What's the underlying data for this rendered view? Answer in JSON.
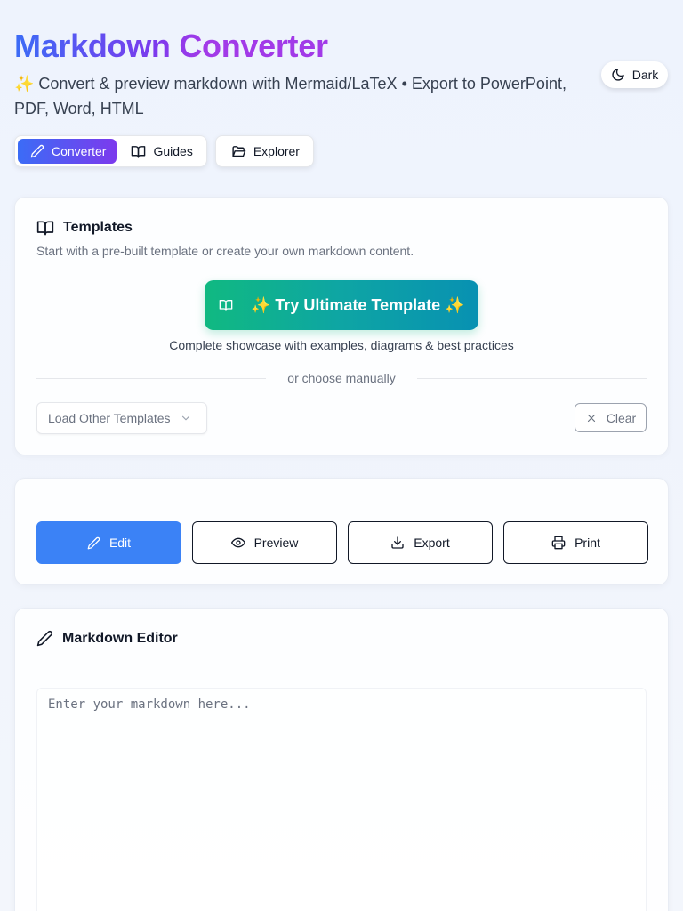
{
  "header": {
    "title": "Markdown Converter",
    "subtitle": "✨ Convert & preview markdown with Mermaid/LaTeX • Export to PowerPoint, PDF, Word, HTML",
    "theme_toggle": {
      "label": "Dark",
      "icon": "moon-icon"
    }
  },
  "nav": {
    "tabs": [
      {
        "label": "Converter",
        "icon": "pencil-icon",
        "active": true
      },
      {
        "label": "Guides",
        "icon": "book-icon",
        "active": false
      },
      {
        "label": "Explorer",
        "icon": "folder-open-icon",
        "active": false
      }
    ]
  },
  "templates": {
    "title": "Templates",
    "description": "Start with a pre-built template or create your own markdown content.",
    "ultimate_button": "✨ Try Ultimate Template ✨",
    "ultimate_caption": "Complete showcase with examples, diagrams & best practices",
    "divider_text": "or choose manually",
    "select_placeholder": "Load Other Templates",
    "clear_label": "Clear"
  },
  "modes": {
    "buttons": [
      {
        "label": "Edit",
        "icon": "pencil-icon",
        "active": true
      },
      {
        "label": "Preview",
        "icon": "eye-icon",
        "active": false
      },
      {
        "label": "Export",
        "icon": "download-icon",
        "active": false
      },
      {
        "label": "Print",
        "icon": "printer-icon",
        "active": false
      }
    ]
  },
  "editor": {
    "title": "Markdown Editor",
    "placeholder": "Enter your markdown here...",
    "value": ""
  },
  "colors": {
    "accent_blue": "#3b82f6",
    "gradient_start": "#3b6cf6",
    "gradient_end": "#7c3aed",
    "teal_start": "#10b981",
    "teal_end": "#0891b2"
  }
}
